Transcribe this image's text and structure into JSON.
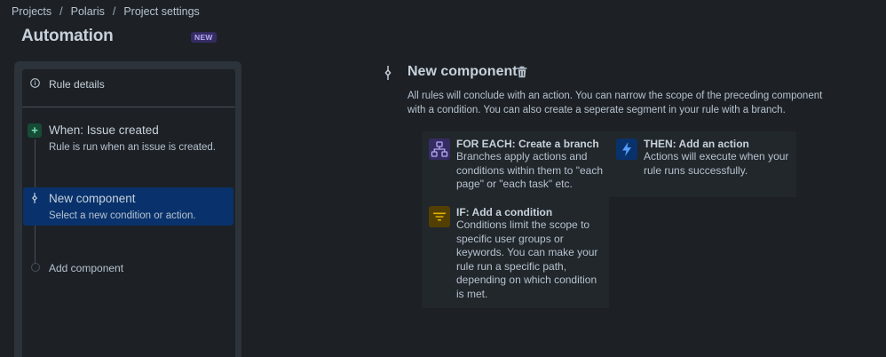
{
  "breadcrumb": {
    "items": [
      "Projects",
      "Polaris",
      "Project settings"
    ],
    "separator": "/"
  },
  "page": {
    "title": "Automation",
    "badge": "NEW"
  },
  "rule_panel": {
    "details_label": "Rule details",
    "trigger": {
      "title": "When: Issue created",
      "description": "Rule is run when an issue is created."
    },
    "selected_step": {
      "title": "New component",
      "description": "Select a new condition or action."
    },
    "add_component_label": "Add component"
  },
  "main": {
    "title": "New component",
    "description": "All rules will conclude with an action. You can narrow the scope of the preceding component with a condition. You can also create a seperate segment in your rule with a branch.",
    "cards": {
      "branch": {
        "title": "FOR EACH: Create a branch",
        "description": "Branches apply actions and conditions within them to \"each page\" or \"each task\" etc.",
        "icon": "branch-icon"
      },
      "action": {
        "title": "THEN: Add an action",
        "description": "Actions will execute when your rule runs successfully.",
        "icon": "lightning-icon"
      },
      "condition": {
        "title": "IF: Add a condition",
        "description": "Conditions limit the scope to specific user groups or keywords. You can make your rule run a specific path, depending on which condition is met.",
        "icon": "filter-icon"
      }
    }
  },
  "colors": {
    "background": "#1d2125",
    "selected": "#09326c",
    "badge_bg": "#352c63",
    "trigger_green": "#164b35",
    "condition_yellow": "#533f04"
  }
}
